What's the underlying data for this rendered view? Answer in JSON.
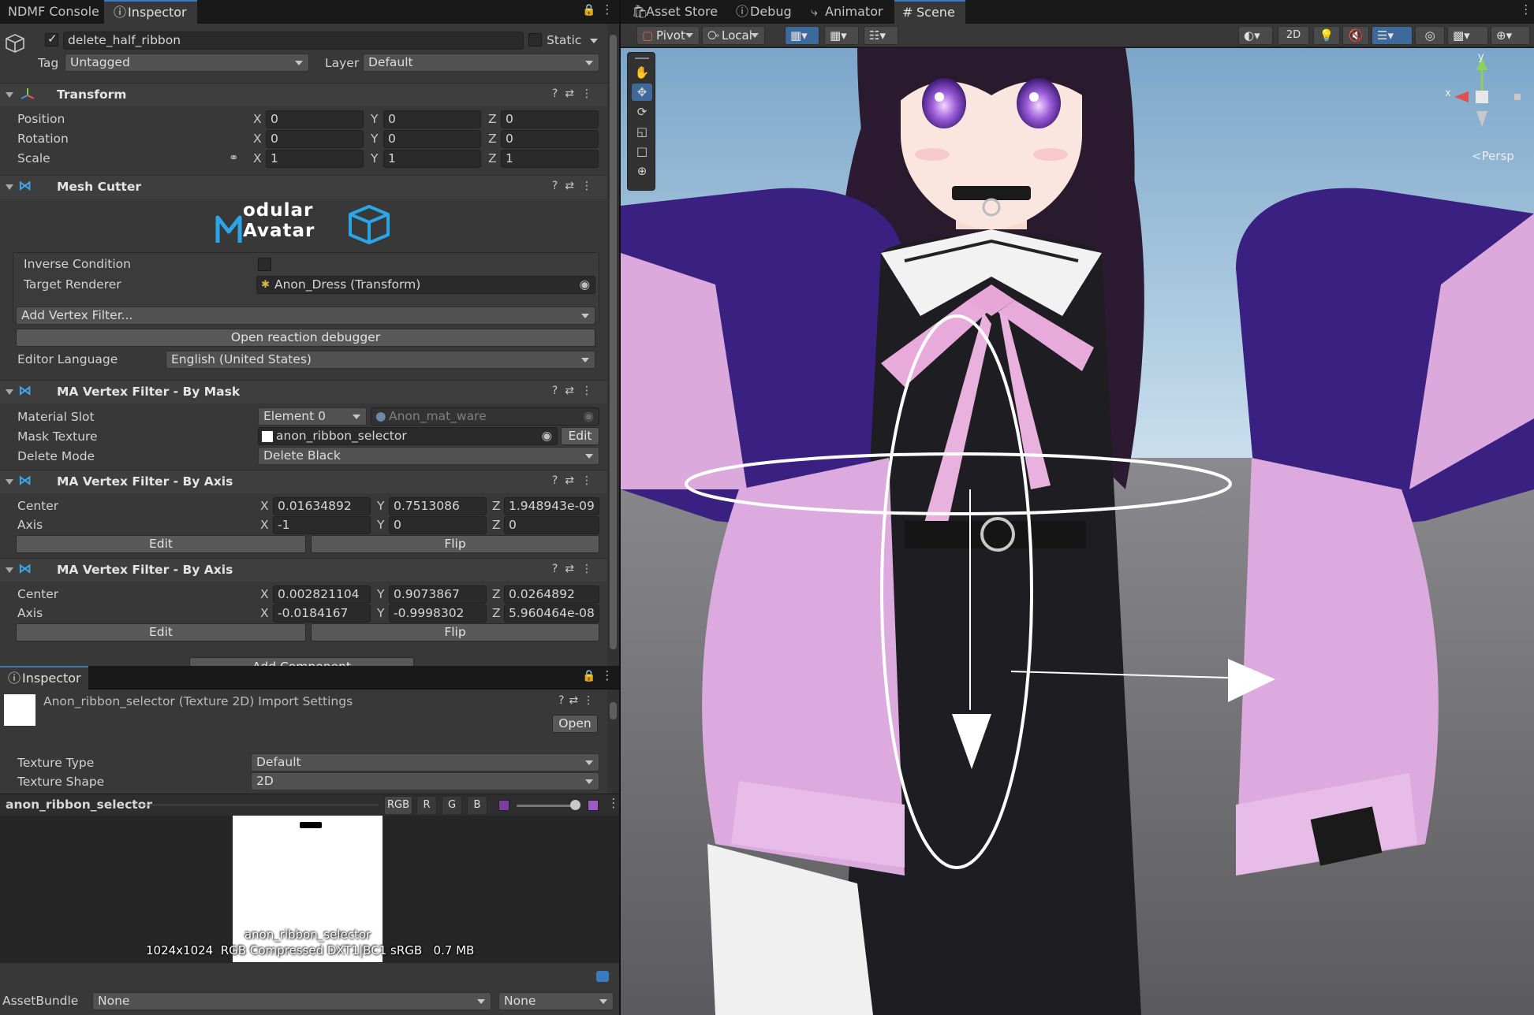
{
  "left_tabs": {
    "console": "NDMF Console",
    "inspector": "Inspector"
  },
  "right_tabs": {
    "asset_store": "Asset Store",
    "debug": "Debug",
    "animator": "Animator",
    "scene": "Scene"
  },
  "object": {
    "name": "delete_half_ribbon",
    "static_label": "Static",
    "tag_label": "Tag",
    "tag_value": "Untagged",
    "layer_label": "Layer",
    "layer_value": "Default"
  },
  "transform": {
    "title": "Transform",
    "position_label": "Position",
    "rotation_label": "Rotation",
    "scale_label": "Scale",
    "position": [
      "0",
      "0",
      "0"
    ],
    "rotation": [
      "0",
      "0",
      "0"
    ],
    "scale": [
      "1",
      "1",
      "1"
    ]
  },
  "axis_letters": {
    "x": "X",
    "y": "Y",
    "z": "Z"
  },
  "mesh_cutter": {
    "title": "Mesh Cutter",
    "logo_line1": "odular",
    "logo_line2": "Avatar",
    "inverse_label": "Inverse Condition",
    "target_label": "Target Renderer",
    "target_value": "Anon_Dress (Transform)",
    "add_filter": "Add Vertex Filter...",
    "debugger_button": "Open reaction debugger",
    "lang_label": "Editor Language",
    "lang_value": "English (United States)"
  },
  "by_mask": {
    "title": "MA Vertex Filter - By Mask",
    "material_label": "Material Slot",
    "material_value": "Element 0",
    "material_ref": "Anon_mat_ware",
    "mask_label": "Mask Texture",
    "mask_value": "anon_ribbon_selector",
    "edit": "Edit",
    "delete_label": "Delete Mode",
    "delete_value": "Delete Black"
  },
  "axis1": {
    "title": "MA Vertex Filter - By Axis",
    "center_label": "Center",
    "axis_label": "Axis",
    "center": [
      "0.01634892",
      "0.7513086",
      "1.948943e-09"
    ],
    "axis": [
      "-1",
      "0",
      "0"
    ],
    "edit": "Edit",
    "flip": "Flip"
  },
  "axis2": {
    "title": "MA Vertex Filter - By Axis",
    "center_label": "Center",
    "axis_label": "Axis",
    "center": [
      "0.002821104",
      "0.9073867",
      "0.0264892"
    ],
    "axis": [
      "-0.0184167",
      "-0.9998302",
      "5.960464e-08"
    ],
    "edit": "Edit",
    "flip": "Flip"
  },
  "add_component": "Add Component",
  "inspector2": {
    "tab": "Inspector",
    "title": "Anon_ribbon_selector (Texture 2D) Import Settings",
    "open": "Open",
    "type_label": "Texture Type",
    "type_value": "Default",
    "shape_label": "Texture Shape",
    "shape_value": "2D"
  },
  "preview": {
    "name": "anon_ribbon_selector",
    "channels": [
      "RGB",
      "R",
      "G",
      "B"
    ],
    "caption_name": "anon_ribbon_selector",
    "caption_info": "1024x1024  RGB Compressed DXT1|BC1 sRGB   0.7 MB"
  },
  "assetbundle": {
    "label": "AssetBundle",
    "name": "None",
    "variant": "None"
  },
  "scene_toolbar": {
    "pivot": "Pivot",
    "local": "Local",
    "mode2d": "2D"
  },
  "gizmo": {
    "x": "x",
    "y": "y",
    "persp": "<Persp"
  },
  "colors": {
    "accent": "#3a79bb",
    "panel": "#383838",
    "field": "#2a2a2a"
  }
}
